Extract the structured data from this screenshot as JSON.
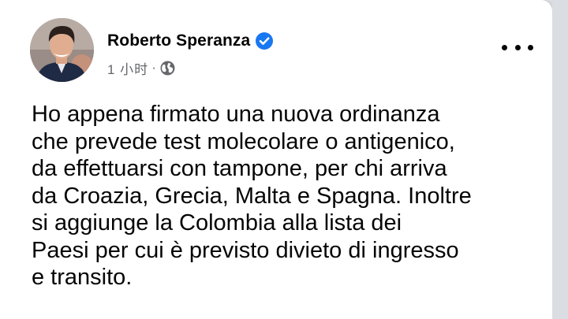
{
  "post": {
    "author_name": "Roberto Speranza",
    "verified": true,
    "timestamp": "1 小时",
    "separator": "·",
    "audience_icon": "globe-icon",
    "more_icon": "more-options-icon",
    "body": "Ho appena firmato una nuova ordinanza\nche prevede test molecolare o antigenico,\nda effettuarsi con tampone, per chi arriva\nda Croazia, Grecia, Malta e Spagna. Inoltre\nsi aggiunge la Colombia alla lista dei\nPaesi per cui è previsto divieto di ingresso\ne transito."
  },
  "colors": {
    "verified_blue": "#1877f2",
    "text_primary": "#050505",
    "text_secondary": "#65676b",
    "background": "#dadde1"
  }
}
